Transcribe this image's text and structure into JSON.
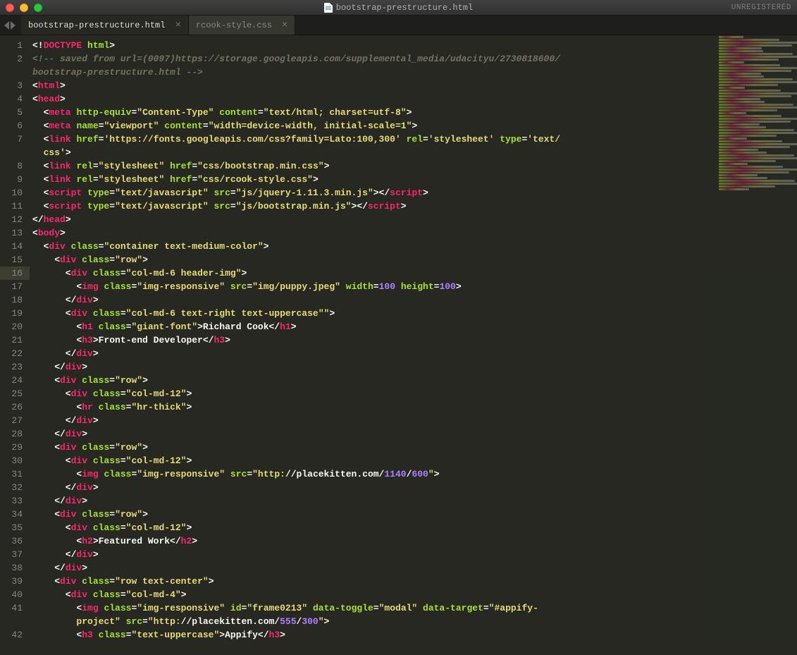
{
  "window": {
    "title": "bootstrap-prestructure.html",
    "status": "UNREGISTERED"
  },
  "tabs": [
    {
      "label": "bootstrap-prestructure.html",
      "active": true
    },
    {
      "label": "rcook-style.css",
      "active": false
    }
  ],
  "gutter": [
    "1",
    "2",
    "",
    "3",
    "4",
    "5",
    "6",
    "7",
    "",
    "8",
    "9",
    "10",
    "11",
    "12",
    "13",
    "14",
    "15",
    "16",
    "17",
    "18",
    "19",
    "20",
    "21",
    "22",
    "23",
    "24",
    "25",
    "26",
    "27",
    "28",
    "29",
    "30",
    "31",
    "32",
    "33",
    "34",
    "35",
    "36",
    "37",
    "38",
    "39",
    "40",
    "41",
    "",
    "42",
    ""
  ],
  "selected_line_index": 17,
  "code_lines": [
    [
      [
        "p",
        "<!"
      ],
      [
        "r",
        "DOCTYPE"
      ],
      [
        "p",
        " "
      ],
      [
        "g",
        "html"
      ],
      [
        "p",
        ">"
      ]
    ],
    [
      [
        "c",
        "<!-- saved from url=(0097)https://storage.googleapis.com/supplemental_media/udacityu/2730818600/"
      ]
    ],
    [
      [
        "c",
        "bootstrap-prestructure.html -->"
      ]
    ],
    [
      [
        "p",
        "<"
      ],
      [
        "r",
        "html"
      ],
      [
        "p",
        ">"
      ]
    ],
    [
      [
        "p",
        "<"
      ],
      [
        "r",
        "head"
      ],
      [
        "p",
        ">"
      ]
    ],
    [
      [
        "p",
        "  <"
      ],
      [
        "r",
        "meta"
      ],
      [
        "p",
        " "
      ],
      [
        "g",
        "http-equiv"
      ],
      [
        "p",
        "="
      ],
      [
        "y",
        "\"Content-Type\""
      ],
      [
        "p",
        " "
      ],
      [
        "g",
        "content"
      ],
      [
        "p",
        "="
      ],
      [
        "y",
        "\"text/html; charset=utf-8\""
      ],
      [
        "p",
        ">"
      ]
    ],
    [
      [
        "p",
        "  <"
      ],
      [
        "r",
        "meta"
      ],
      [
        "p",
        " "
      ],
      [
        "g",
        "name"
      ],
      [
        "p",
        "="
      ],
      [
        "y",
        "\"viewport\""
      ],
      [
        "p",
        " "
      ],
      [
        "g",
        "content"
      ],
      [
        "p",
        "="
      ],
      [
        "y",
        "\"width=device-width, initial-scale=1\""
      ],
      [
        "p",
        ">"
      ]
    ],
    [
      [
        "p",
        "  <"
      ],
      [
        "r",
        "link"
      ],
      [
        "p",
        " "
      ],
      [
        "g",
        "href"
      ],
      [
        "p",
        "="
      ],
      [
        "y",
        "'https://fonts.googleapis.com/css?family=Lato:100,300'"
      ],
      [
        "p",
        " "
      ],
      [
        "g",
        "rel"
      ],
      [
        "p",
        "="
      ],
      [
        "y",
        "'stylesheet'"
      ],
      [
        "p",
        " "
      ],
      [
        "g",
        "type"
      ],
      [
        "p",
        "="
      ],
      [
        "y",
        "'text/"
      ]
    ],
    [
      [
        "y",
        "  css'"
      ],
      [
        "p",
        ">"
      ]
    ],
    [
      [
        "p",
        "  <"
      ],
      [
        "r",
        "link"
      ],
      [
        "p",
        " "
      ],
      [
        "g",
        "rel"
      ],
      [
        "p",
        "="
      ],
      [
        "y",
        "\"stylesheet\""
      ],
      [
        "p",
        " "
      ],
      [
        "g",
        "href"
      ],
      [
        "p",
        "="
      ],
      [
        "y",
        "\"css/bootstrap.min.css\""
      ],
      [
        "p",
        ">"
      ]
    ],
    [
      [
        "p",
        "  <"
      ],
      [
        "r",
        "link"
      ],
      [
        "p",
        " "
      ],
      [
        "g",
        "rel"
      ],
      [
        "p",
        "="
      ],
      [
        "y",
        "\"stylesheet\""
      ],
      [
        "p",
        " "
      ],
      [
        "g",
        "href"
      ],
      [
        "p",
        "="
      ],
      [
        "y",
        "\"css/rcook-style.css\""
      ],
      [
        "p",
        ">"
      ]
    ],
    [
      [
        "p",
        "  <"
      ],
      [
        "r",
        "script"
      ],
      [
        "p",
        " "
      ],
      [
        "g",
        "type"
      ],
      [
        "p",
        "="
      ],
      [
        "y",
        "\"text/javascript\""
      ],
      [
        "p",
        " "
      ],
      [
        "g",
        "src"
      ],
      [
        "p",
        "="
      ],
      [
        "y",
        "\"js/jquery-1.11.3.min.js\""
      ],
      [
        "p",
        "></"
      ],
      [
        "r",
        "script"
      ],
      [
        "p",
        ">"
      ]
    ],
    [
      [
        "p",
        "  <"
      ],
      [
        "r",
        "script"
      ],
      [
        "p",
        " "
      ],
      [
        "g",
        "type"
      ],
      [
        "p",
        "="
      ],
      [
        "y",
        "\"text/javascript\""
      ],
      [
        "p",
        " "
      ],
      [
        "g",
        "src"
      ],
      [
        "p",
        "="
      ],
      [
        "y",
        "\"js/bootstrap.min.js\""
      ],
      [
        "p",
        "></"
      ],
      [
        "r",
        "script"
      ],
      [
        "p",
        ">"
      ]
    ],
    [
      [
        "p",
        "</"
      ],
      [
        "r",
        "head"
      ],
      [
        "p",
        ">"
      ]
    ],
    [
      [
        "p",
        "<"
      ],
      [
        "r",
        "body"
      ],
      [
        "p",
        ">"
      ]
    ],
    [
      [
        "p",
        "  <"
      ],
      [
        "r",
        "div"
      ],
      [
        "p",
        " "
      ],
      [
        "g",
        "class"
      ],
      [
        "p",
        "="
      ],
      [
        "y",
        "\"container text-medium-color\""
      ],
      [
        "p",
        ">"
      ]
    ],
    [
      [
        "p",
        "    <"
      ],
      [
        "r",
        "div"
      ],
      [
        "p",
        " "
      ],
      [
        "g",
        "class"
      ],
      [
        "p",
        "="
      ],
      [
        "y",
        "\"row\""
      ],
      [
        "p",
        ">"
      ]
    ],
    [
      [
        "p",
        "      <"
      ],
      [
        "r",
        "div"
      ],
      [
        "p",
        " "
      ],
      [
        "g",
        "class"
      ],
      [
        "p",
        "="
      ],
      [
        "y",
        "\"col-md-6 header-img\""
      ],
      [
        "p",
        ">"
      ]
    ],
    [
      [
        "p",
        "        <"
      ],
      [
        "r",
        "img"
      ],
      [
        "p",
        " "
      ],
      [
        "g",
        "class"
      ],
      [
        "p",
        "="
      ],
      [
        "y",
        "\"img-responsive\""
      ],
      [
        "p",
        " "
      ],
      [
        "g",
        "src"
      ],
      [
        "p",
        "="
      ],
      [
        "y",
        "\"img/puppy.jpeg\""
      ],
      [
        "p",
        " "
      ],
      [
        "g",
        "width"
      ],
      [
        "p",
        "="
      ],
      [
        "pp",
        "100"
      ],
      [
        "p",
        " "
      ],
      [
        "g",
        "height"
      ],
      [
        "p",
        "="
      ],
      [
        "pp",
        "100"
      ],
      [
        "p",
        ">"
      ]
    ],
    [
      [
        "p",
        "      </"
      ],
      [
        "r",
        "div"
      ],
      [
        "p",
        ">"
      ]
    ],
    [
      [
        "p",
        "      <"
      ],
      [
        "r",
        "div"
      ],
      [
        "p",
        " "
      ],
      [
        "g",
        "class"
      ],
      [
        "p",
        "="
      ],
      [
        "y",
        "\"col-md-6 text-right text-uppercase\"\""
      ],
      [
        "p",
        ">"
      ]
    ],
    [
      [
        "p",
        "        <"
      ],
      [
        "r",
        "h1"
      ],
      [
        "p",
        " "
      ],
      [
        "g",
        "class"
      ],
      [
        "p",
        "="
      ],
      [
        "y",
        "\"giant-font\""
      ],
      [
        "p",
        ">Richard Cook</"
      ],
      [
        "r",
        "h1"
      ],
      [
        "p",
        ">"
      ]
    ],
    [
      [
        "p",
        "        <"
      ],
      [
        "r",
        "h3"
      ],
      [
        "p",
        ">Front-end Developer</"
      ],
      [
        "r",
        "h3"
      ],
      [
        "p",
        ">"
      ]
    ],
    [
      [
        "p",
        "      </"
      ],
      [
        "r",
        "div"
      ],
      [
        "p",
        ">"
      ]
    ],
    [
      [
        "p",
        "    </"
      ],
      [
        "r",
        "div"
      ],
      [
        "p",
        ">"
      ]
    ],
    [
      [
        "p",
        "    <"
      ],
      [
        "r",
        "div"
      ],
      [
        "p",
        " "
      ],
      [
        "g",
        "class"
      ],
      [
        "p",
        "="
      ],
      [
        "y",
        "\"row\""
      ],
      [
        "p",
        ">"
      ]
    ],
    [
      [
        "p",
        "      <"
      ],
      [
        "r",
        "div"
      ],
      [
        "p",
        " "
      ],
      [
        "g",
        "class"
      ],
      [
        "p",
        "="
      ],
      [
        "y",
        "\"col-md-12\""
      ],
      [
        "p",
        ">"
      ]
    ],
    [
      [
        "p",
        "        <"
      ],
      [
        "r",
        "hr"
      ],
      [
        "p",
        " "
      ],
      [
        "g",
        "class"
      ],
      [
        "p",
        "="
      ],
      [
        "y",
        "\"hr-thick\""
      ],
      [
        "p",
        ">"
      ]
    ],
    [
      [
        "p",
        "      </"
      ],
      [
        "r",
        "div"
      ],
      [
        "p",
        ">"
      ]
    ],
    [
      [
        "p",
        "    </"
      ],
      [
        "r",
        "div"
      ],
      [
        "p",
        ">"
      ]
    ],
    [
      [
        "p",
        "    <"
      ],
      [
        "r",
        "div"
      ],
      [
        "p",
        " "
      ],
      [
        "g",
        "class"
      ],
      [
        "p",
        "="
      ],
      [
        "y",
        "\"row\""
      ],
      [
        "p",
        ">"
      ]
    ],
    [
      [
        "p",
        "      <"
      ],
      [
        "r",
        "div"
      ],
      [
        "p",
        " "
      ],
      [
        "g",
        "class"
      ],
      [
        "p",
        "="
      ],
      [
        "y",
        "\"col-md-12\""
      ],
      [
        "p",
        ">"
      ]
    ],
    [
      [
        "p",
        "        <"
      ],
      [
        "r",
        "img"
      ],
      [
        "p",
        " "
      ],
      [
        "g",
        "class"
      ],
      [
        "p",
        "="
      ],
      [
        "y",
        "\"img-responsive\""
      ],
      [
        "p",
        " "
      ],
      [
        "g",
        "src"
      ],
      [
        "p",
        "="
      ],
      [
        "y",
        "\"http:"
      ],
      [
        "p",
        "//placekitten.com/"
      ],
      [
        "pp",
        "1140"
      ],
      [
        "p",
        "/"
      ],
      [
        "pp",
        "600"
      ],
      [
        "y",
        "\""
      ],
      [
        "p",
        ">"
      ]
    ],
    [
      [
        "p",
        "      </"
      ],
      [
        "r",
        "div"
      ],
      [
        "p",
        ">"
      ]
    ],
    [
      [
        "p",
        "    </"
      ],
      [
        "r",
        "div"
      ],
      [
        "p",
        ">"
      ]
    ],
    [
      [
        "p",
        "    <"
      ],
      [
        "r",
        "div"
      ],
      [
        "p",
        " "
      ],
      [
        "g",
        "class"
      ],
      [
        "p",
        "="
      ],
      [
        "y",
        "\"row\""
      ],
      [
        "p",
        ">"
      ]
    ],
    [
      [
        "p",
        "      <"
      ],
      [
        "r",
        "div"
      ],
      [
        "p",
        " "
      ],
      [
        "g",
        "class"
      ],
      [
        "p",
        "="
      ],
      [
        "y",
        "\"col-md-12\""
      ],
      [
        "p",
        ">"
      ]
    ],
    [
      [
        "p",
        "        <"
      ],
      [
        "r",
        "h2"
      ],
      [
        "p",
        ">Featured Work</"
      ],
      [
        "r",
        "h2"
      ],
      [
        "p",
        ">"
      ]
    ],
    [
      [
        "p",
        "      </"
      ],
      [
        "r",
        "div"
      ],
      [
        "p",
        ">"
      ]
    ],
    [
      [
        "p",
        "    </"
      ],
      [
        "r",
        "div"
      ],
      [
        "p",
        ">"
      ]
    ],
    [
      [
        "p",
        "    <"
      ],
      [
        "r",
        "div"
      ],
      [
        "p",
        " "
      ],
      [
        "g",
        "class"
      ],
      [
        "p",
        "="
      ],
      [
        "y",
        "\"row text-center\""
      ],
      [
        "p",
        ">"
      ]
    ],
    [
      [
        "p",
        "      <"
      ],
      [
        "r",
        "div"
      ],
      [
        "p",
        " "
      ],
      [
        "g",
        "class"
      ],
      [
        "p",
        "="
      ],
      [
        "y",
        "\"col-md-4\""
      ],
      [
        "p",
        ">"
      ]
    ],
    [
      [
        "p",
        "        <"
      ],
      [
        "r",
        "img"
      ],
      [
        "p",
        " "
      ],
      [
        "g",
        "class"
      ],
      [
        "p",
        "="
      ],
      [
        "y",
        "\"img-responsive\""
      ],
      [
        "p",
        " "
      ],
      [
        "g",
        "id"
      ],
      [
        "p",
        "="
      ],
      [
        "y",
        "\"frame0213\""
      ],
      [
        "p",
        " "
      ],
      [
        "g",
        "data-toggle"
      ],
      [
        "p",
        "="
      ],
      [
        "y",
        "\"modal\""
      ],
      [
        "p",
        " "
      ],
      [
        "g",
        "data-target"
      ],
      [
        "p",
        "="
      ],
      [
        "y",
        "\"#appify-"
      ]
    ],
    [
      [
        "y",
        "        project\""
      ],
      [
        "p",
        " "
      ],
      [
        "g",
        "src"
      ],
      [
        "p",
        "="
      ],
      [
        "y",
        "\"http:"
      ],
      [
        "p",
        "//placekitten.com/"
      ],
      [
        "pp",
        "555"
      ],
      [
        "p",
        "/"
      ],
      [
        "pp",
        "300"
      ],
      [
        "y",
        "\""
      ],
      [
        "p",
        ">"
      ]
    ],
    [
      [
        "p",
        "        <"
      ],
      [
        "r",
        "h3"
      ],
      [
        "p",
        " "
      ],
      [
        "g",
        "class"
      ],
      [
        "p",
        "="
      ],
      [
        "y",
        "\"text-uppercase\""
      ],
      [
        "p",
        ">Appify</"
      ],
      [
        "r",
        "h3"
      ],
      [
        "p",
        ">"
      ]
    ],
    [
      [
        "p",
        "                "
      ]
    ]
  ]
}
